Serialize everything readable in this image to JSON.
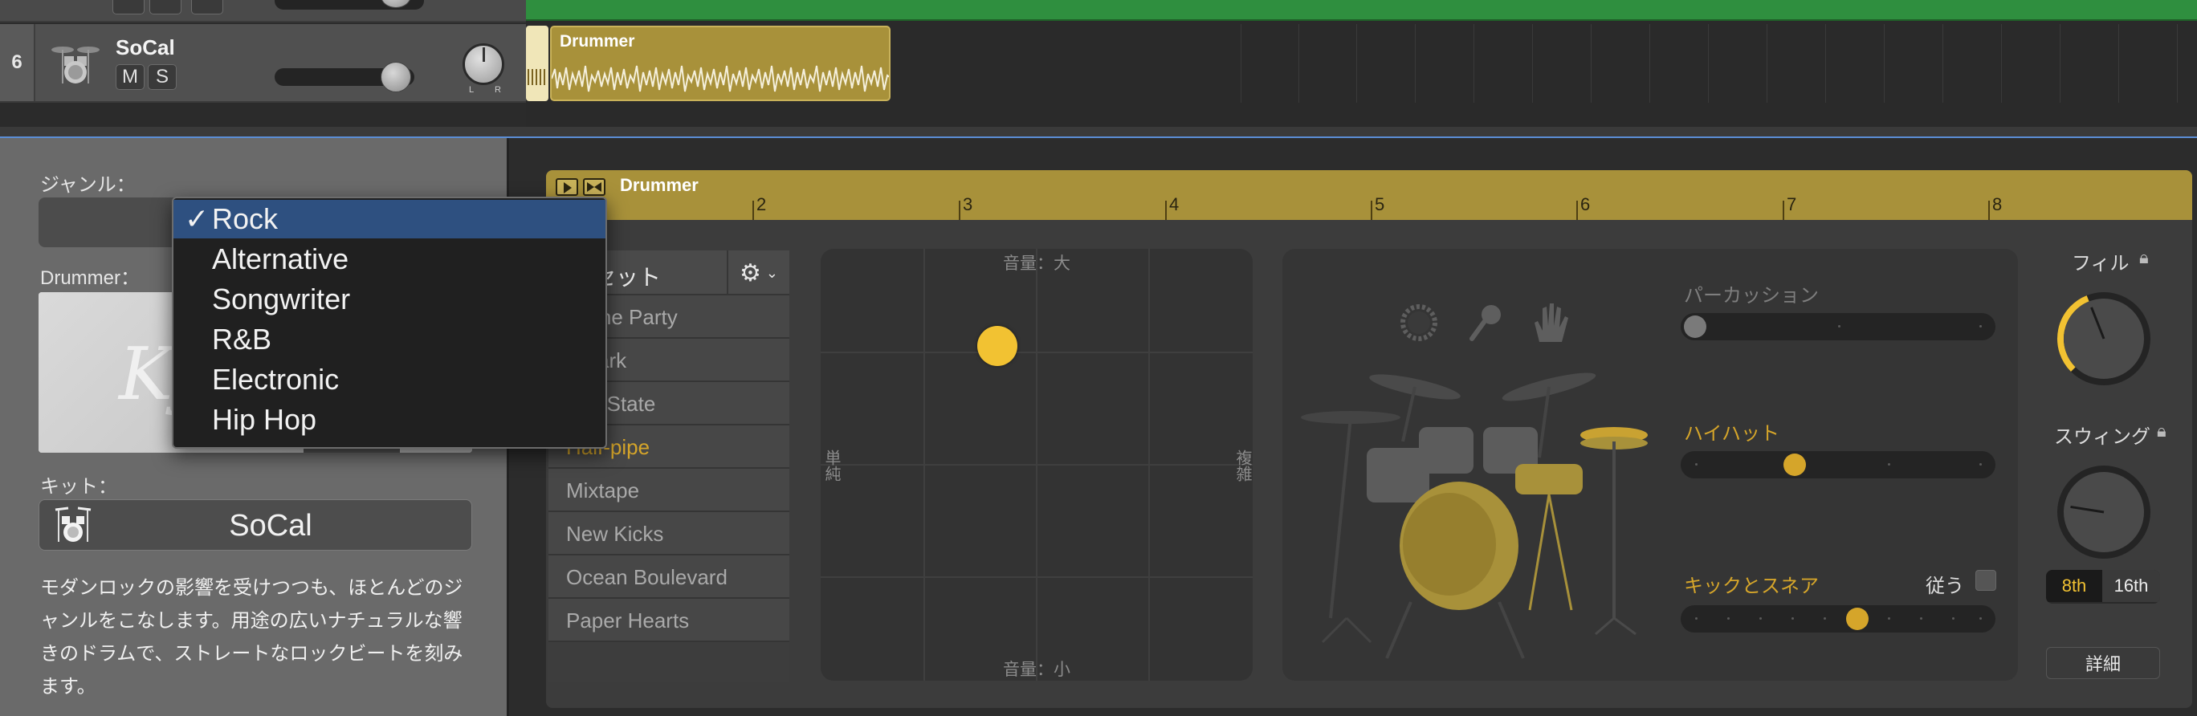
{
  "tracks": {
    "track6": {
      "number": "6",
      "name": "SoCal",
      "mute_label": "M",
      "solo_label": "S",
      "pan_l": "L",
      "pan_r": "R",
      "region_label": "Drummer"
    }
  },
  "left_panel": {
    "genre_label": "ジャンル：",
    "drummer_label": "Drummer：",
    "drummer_name_partial": "Ky",
    "kit_label": "キット：",
    "kit_value": "SoCal",
    "description": "モダンロックの影響を受けつつも、ほとんどのジャンルをこなします。用途の広いナチュラルな響きのドラムで、ストレートなロックビートを刻みます。",
    "description_lines": [
      "モダンロックの影響を受けつつも、ほとんどのジ",
      "ャンルをこなします。用途の広いナチュラルな響",
      "きのドラムで、ストレートなロックビートを刻み",
      "ます。"
    ]
  },
  "genre_menu": {
    "selected": "Rock",
    "check": "✓",
    "items": [
      "Rock",
      "Alternative",
      "Songwriter",
      "R&B",
      "Electronic",
      "Hip Hop"
    ]
  },
  "region": {
    "title": "Drummer",
    "ruler": [
      "2",
      "3",
      "4",
      "5",
      "6",
      "7",
      "8"
    ]
  },
  "presets": {
    "header": "セット",
    "items": [
      "sh the Party",
      "p Park",
      "den State",
      "Half-pipe",
      "Mixtape",
      "New Kicks",
      "Ocean Boulevard",
      "Paper Hearts"
    ],
    "selected": "Half-pipe"
  },
  "xy_pad": {
    "top": "音量：大",
    "bottom": "音量：小",
    "left": "単純",
    "right": "複雑",
    "puck": {
      "complexity": 0.35,
      "loudness": 0.78
    }
  },
  "controls": {
    "percussion_label": "パーカッション",
    "hihat_label": "ハイハット",
    "kick_snare_label": "キックとスネア",
    "follow_label": "従う",
    "percussion_value": 0.0,
    "hihat_value": 0.35,
    "kick_snare_value": 0.56
  },
  "right_controls": {
    "fill_label": "フィル",
    "swing_label": "スウィング",
    "seg_8th": "8th",
    "seg_16th": "16th",
    "details_label": "詳細",
    "fill_value": 0.42,
    "swing_value": 0.2
  },
  "colors": {
    "accent_yellow": "#d5a52a",
    "region_gold": "#a8913a",
    "selection_blue": "#2e5080",
    "green_region": "#2f8f3f"
  }
}
